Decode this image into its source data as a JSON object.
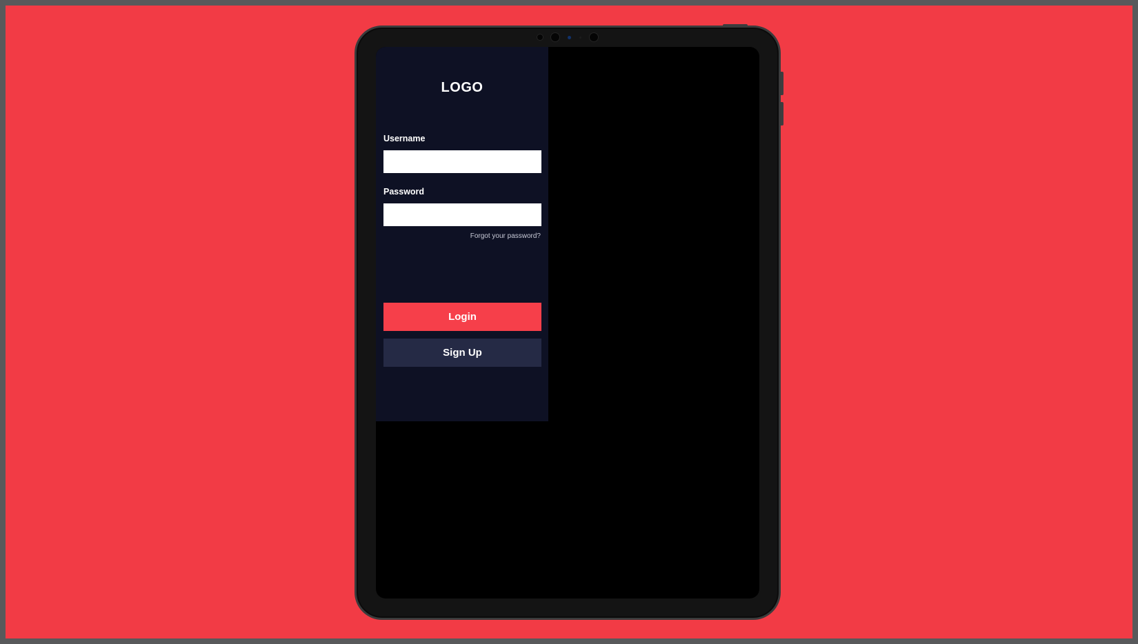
{
  "colors": {
    "background": "#f23b45",
    "frame": "#58595b",
    "device_body": "#141414",
    "screen": "#000000",
    "panel": "#0e1124",
    "login_button": "#f63f4a",
    "signup_button": "#252a45",
    "text": "#ffffff"
  },
  "login": {
    "logo": "LOGO",
    "username_label": "Username",
    "username_value": "",
    "password_label": "Password",
    "password_value": "",
    "forgot_password": "Forgot your password?",
    "login_button": "Login",
    "signup_button": "Sign Up"
  },
  "icons": {
    "camera": "front-camera-icon",
    "sensor": "sensor-icon"
  }
}
